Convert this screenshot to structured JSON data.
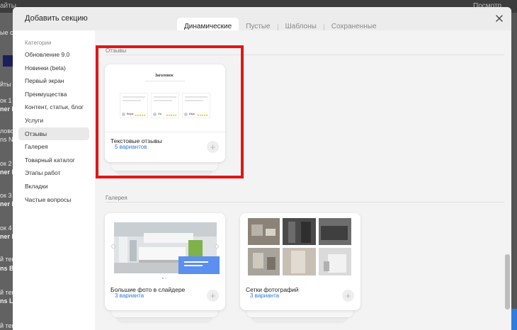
{
  "background": {
    "top_left_text": "айты",
    "top_right_text": "Посмотр. пол",
    "left_fragments": [
      {
        "text": "ые ст",
        "bold": false
      },
      {
        "text": "йты",
        "bold": false
      },
      {
        "text": "ок 1",
        "bold": false
      },
      {
        "text": "ner Bo",
        "bold": true
      },
      {
        "text": "лово",
        "bold": false
      },
      {
        "text": "ns No",
        "bold": false
      },
      {
        "text": "ок 2",
        "bold": false
      },
      {
        "text": "ner Bo",
        "bold": true
      },
      {
        "text": "ок 3",
        "bold": false
      },
      {
        "text": "ner Bo",
        "bold": true
      },
      {
        "text": "ок 4",
        "bold": false
      },
      {
        "text": "ner Bo",
        "bold": true
      },
      {
        "text": "й текс",
        "bold": false
      },
      {
        "text": "ns Bo",
        "bold": true
      },
      {
        "text": "й текс",
        "bold": false
      },
      {
        "text": "ns Ligh",
        "bold": true
      },
      {
        "text": "й текс",
        "bold": false
      }
    ]
  },
  "modal": {
    "title": "Добавить секцию",
    "close_icon": "close-icon",
    "tabs": [
      {
        "label": "Динамические",
        "active": true
      },
      {
        "label": "Пустые",
        "active": false
      },
      {
        "label": "Шаблоны",
        "active": false
      },
      {
        "label": "Сохраненные",
        "active": false
      }
    ]
  },
  "sidebar": {
    "heading": "Категории",
    "items": [
      {
        "label": "Обновление 9.0",
        "active": false
      },
      {
        "label": "Новинки (beta)",
        "active": false
      },
      {
        "label": "Первый экран",
        "active": false
      },
      {
        "label": "Преимущества",
        "active": false
      },
      {
        "label": "Контент, статьи, блог",
        "active": false
      },
      {
        "label": "Услуги",
        "active": false
      },
      {
        "label": "Отзывы",
        "active": true
      },
      {
        "label": "Галерея",
        "active": false
      },
      {
        "label": "Товарный каталог",
        "active": false
      },
      {
        "label": "Этапы работ",
        "active": false
      },
      {
        "label": "Вкладки",
        "active": false
      },
      {
        "label": "Частые вопросы",
        "active": false
      }
    ]
  },
  "sections": {
    "reviews": {
      "label": "Отзывы",
      "cards": [
        {
          "title": "Текстовые отзывы",
          "variants": "5 вариантов",
          "preview_heading": "Заголовок",
          "reviewers": [
            "Вера",
            "Ли",
            "Имя"
          ]
        }
      ]
    },
    "gallery": {
      "label": "Галерея",
      "cards": [
        {
          "title": "Большие фото в слайдере",
          "variants": "3 варианта"
        },
        {
          "title": "Сетки фотографий",
          "variants": "3 варианта"
        }
      ]
    }
  },
  "colors": {
    "highlight": "#e01616",
    "link": "#2f78d6",
    "accent_blue": "#5b8ff0"
  }
}
